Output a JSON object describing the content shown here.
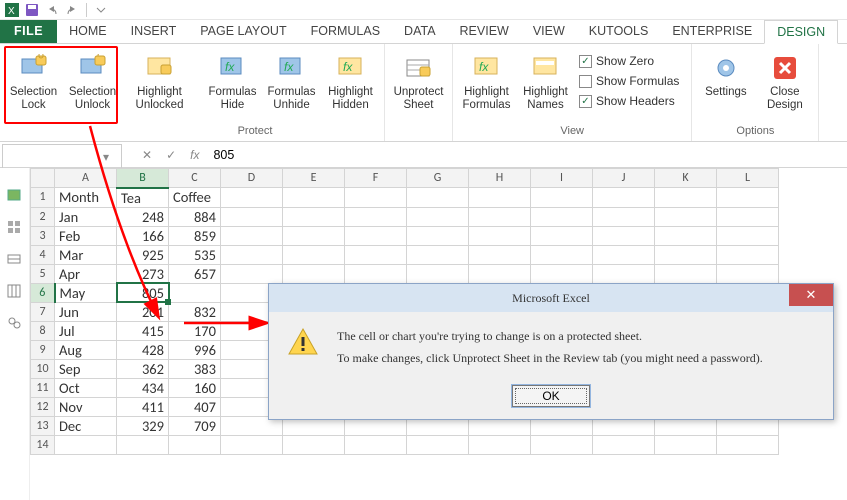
{
  "tabs": {
    "file": "FILE",
    "home": "HOME",
    "insert": "INSERT",
    "pagelayout": "PAGE LAYOUT",
    "formulas": "FORMULAS",
    "data": "DATA",
    "review": "REVIEW",
    "view": "VIEW",
    "kutools": "KUTOOLS",
    "enterprise": "ENTERPRISE",
    "design": "DESIGN"
  },
  "ribbon": {
    "sel_lock": "Selection\nLock",
    "sel_unlock": "Selection\nUnlock",
    "hl_unlocked": "Highlight\nUnlocked",
    "f_hide": "Formulas\nHide",
    "f_unhide": "Formulas\nUnhide",
    "hl_hidden": "Highlight\nHidden",
    "unprotect": "Unprotect\nSheet",
    "hl_formulas": "Highlight\nFormulas",
    "hl_names": "Highlight\nNames",
    "show_zero": "Show Zero",
    "show_formulas": "Show Formulas",
    "show_headers": "Show Headers",
    "settings": "Settings",
    "close_design": "Close\nDesign",
    "group_protect": "Protect",
    "group_view": "View",
    "group_options": "Options"
  },
  "formula_bar": {
    "value": "805",
    "fx": "fx",
    "namebox": ""
  },
  "columns": [
    "A",
    "B",
    "C",
    "D",
    "E",
    "F",
    "G",
    "H",
    "I",
    "J",
    "K",
    "L"
  ],
  "headers": {
    "a": "Month",
    "b": "Tea",
    "c": "Coffee"
  },
  "rows": [
    {
      "m": "Jan",
      "t": 248,
      "c": 884
    },
    {
      "m": "Feb",
      "t": 166,
      "c": 859
    },
    {
      "m": "Mar",
      "t": 925,
      "c": 535
    },
    {
      "m": "Apr",
      "t": 273,
      "c": 657
    },
    {
      "m": "May",
      "t": 805,
      "c": ""
    },
    {
      "m": "Jun",
      "t": 201,
      "c": 832
    },
    {
      "m": "Jul",
      "t": 415,
      "c": 170
    },
    {
      "m": "Aug",
      "t": 428,
      "c": 996
    },
    {
      "m": "Sep",
      "t": 362,
      "c": 383
    },
    {
      "m": "Oct",
      "t": 434,
      "c": 160
    },
    {
      "m": "Nov",
      "t": 411,
      "c": 407
    },
    {
      "m": "Dec",
      "t": 329,
      "c": 709
    }
  ],
  "selected": {
    "col": "B",
    "row": 6
  },
  "checks": {
    "zero": true,
    "formulas": false,
    "headers": true
  },
  "dialog": {
    "title": "Microsoft Excel",
    "line1": "The cell or chart you're trying to change is on a protected sheet.",
    "line2": "To make changes, click Unprotect Sheet in the Review tab (you might need a password).",
    "ok": "OK"
  }
}
